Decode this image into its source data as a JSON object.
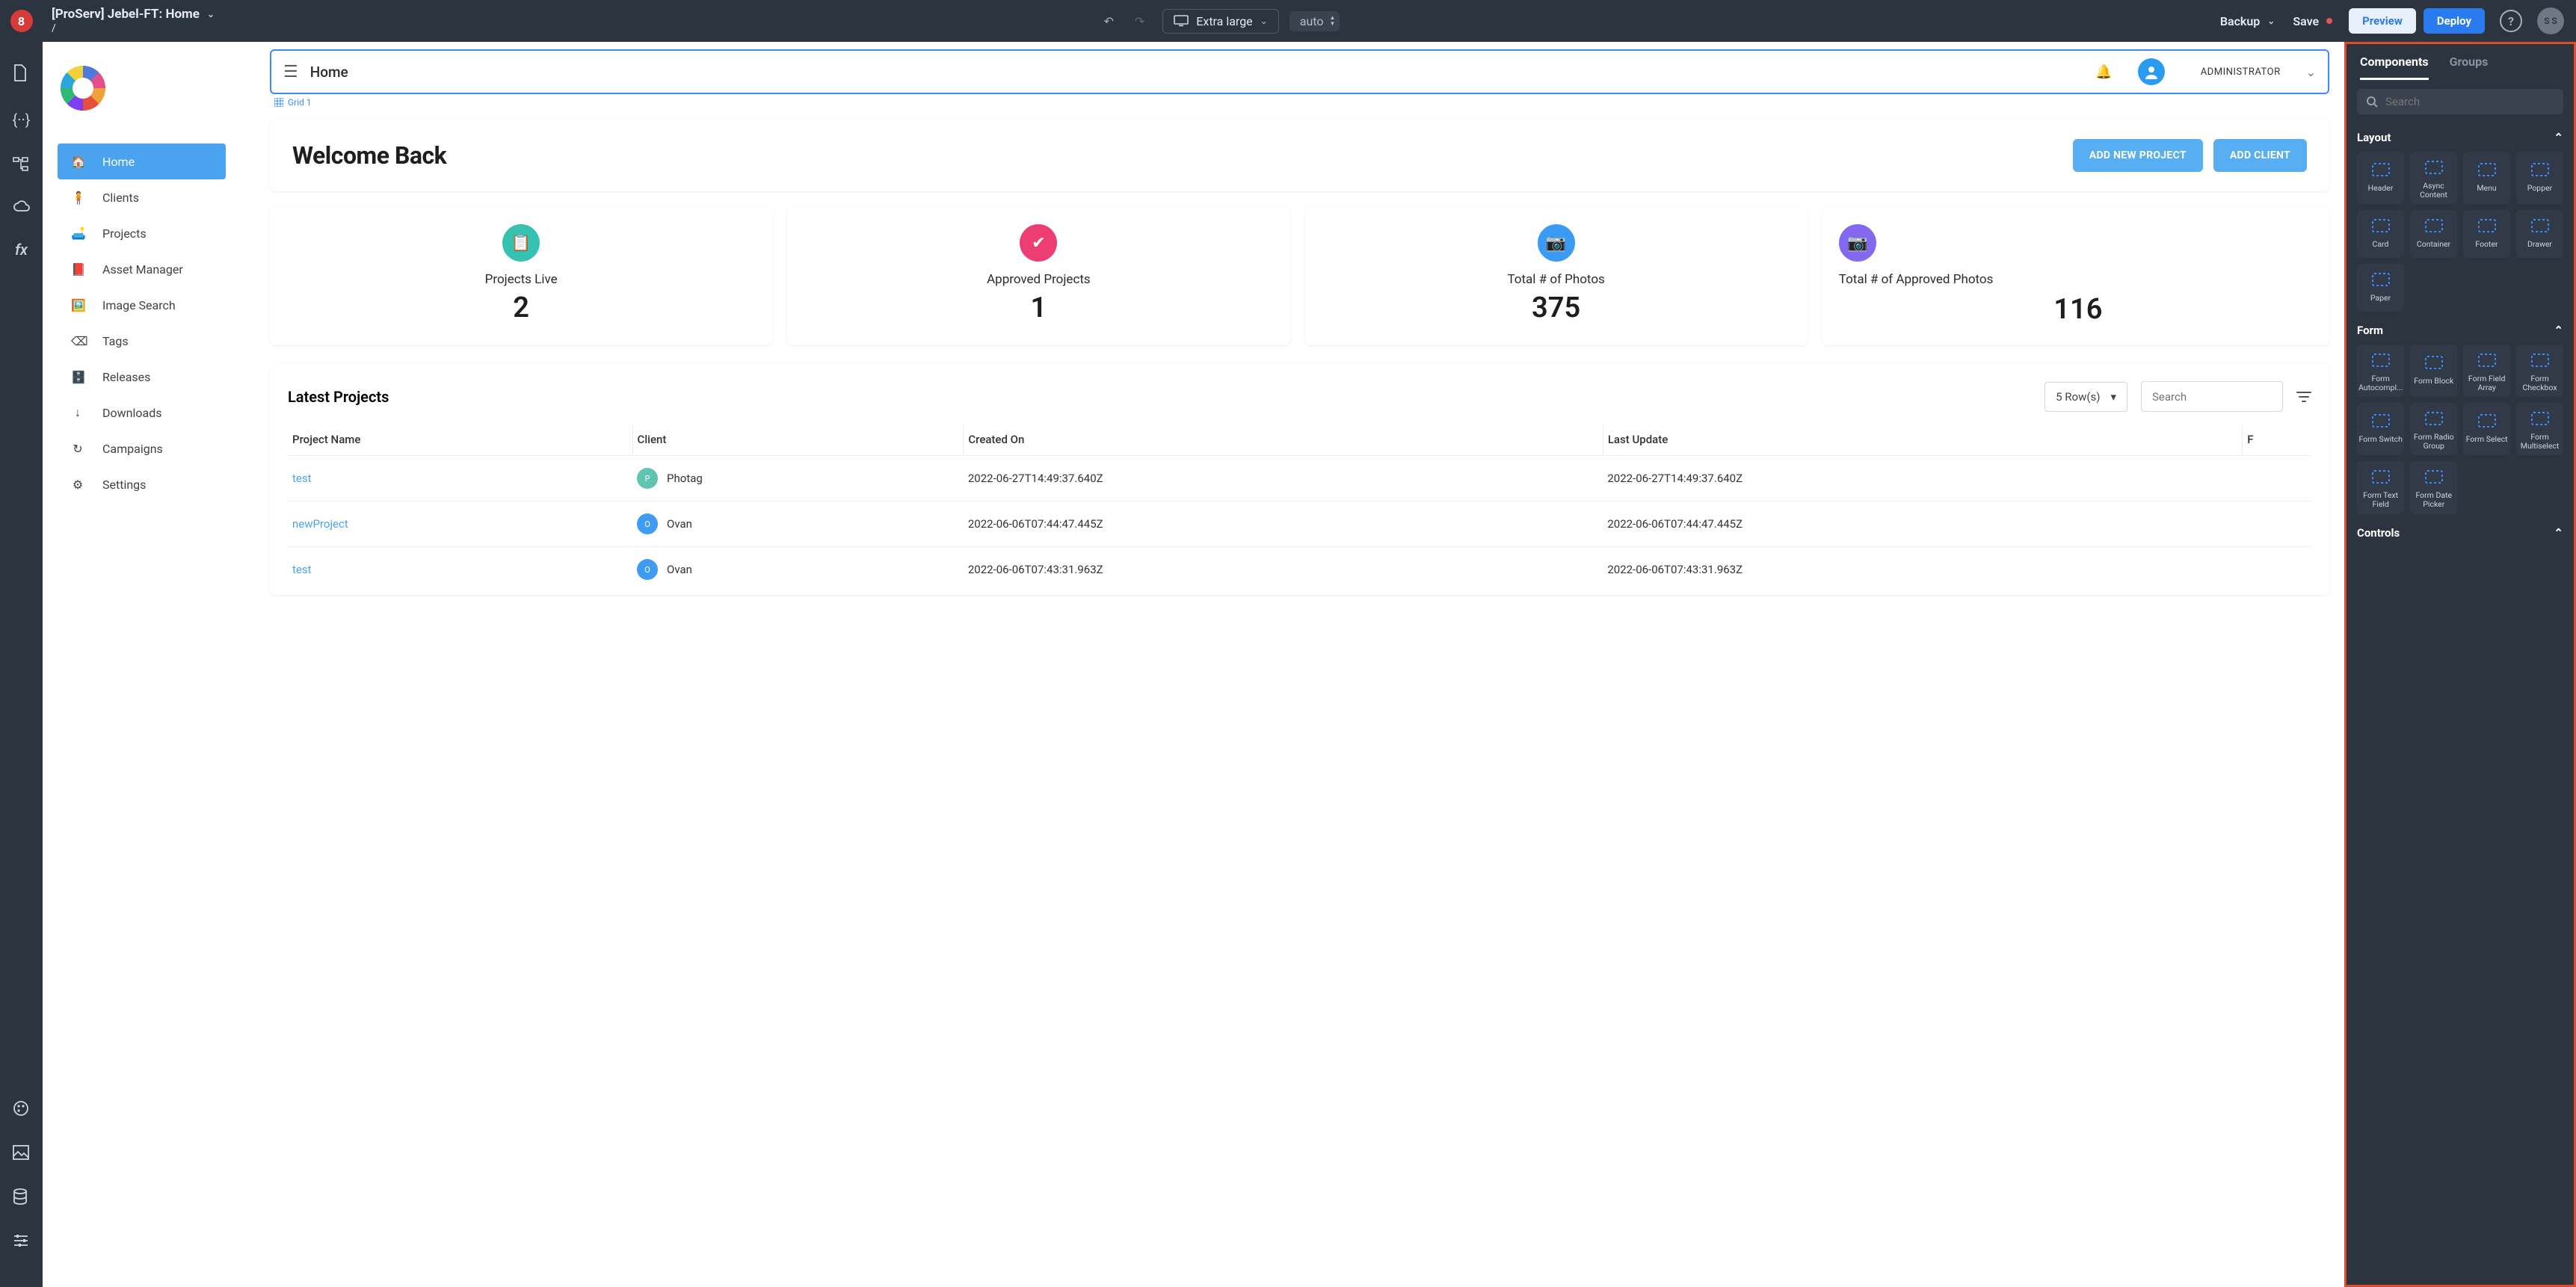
{
  "topbar": {
    "logo_text": "8",
    "title": "[ProServ] Jebel-FT: Home",
    "breadcrumb": "/",
    "viewport_label": "Extra large",
    "auto_label": "auto",
    "backup_label": "Backup",
    "save_label": "Save",
    "preview_label": "Preview",
    "deploy_label": "Deploy",
    "help_glyph": "?",
    "avatar_initials": "S S"
  },
  "appbar": {
    "title": "Home",
    "role": "ADMINISTRATOR",
    "grid_label": "Grid 1"
  },
  "hero": {
    "title": "Welcome Back",
    "add_project": "ADD NEW PROJECT",
    "add_client": "ADD CLIENT"
  },
  "stats": [
    {
      "label": "Projects Live",
      "value": "2",
      "color": "teal"
    },
    {
      "label": "Approved Projects",
      "value": "1",
      "color": "pink"
    },
    {
      "label": "Total # of Photos",
      "value": "375",
      "color": "blue"
    },
    {
      "label": "Total # of Approved Photos",
      "value": "116",
      "color": "purple"
    }
  ],
  "sidebar": {
    "items": [
      {
        "icon": "home",
        "label": "Home",
        "active": true
      },
      {
        "icon": "person",
        "label": "Clients"
      },
      {
        "icon": "folder",
        "label": "Projects"
      },
      {
        "icon": "book",
        "label": "Asset Manager"
      },
      {
        "icon": "image",
        "label": "Image Search"
      },
      {
        "icon": "tag",
        "label": "Tags"
      },
      {
        "icon": "archive",
        "label": "Releases"
      },
      {
        "icon": "download",
        "label": "Downloads"
      },
      {
        "icon": "campaign",
        "label": "Campaigns"
      },
      {
        "icon": "gear",
        "label": "Settings"
      }
    ]
  },
  "table": {
    "title": "Latest Projects",
    "row_selector": "5 Row(s)",
    "search_placeholder": "Search",
    "columns": [
      "Project Name",
      "Client",
      "Created On",
      "Last Update",
      "F"
    ],
    "rows": [
      {
        "name": "test",
        "client": "Photag",
        "badge": "P",
        "bclass": "p",
        "created": "2022-06-27T14:49:37.640Z",
        "updated": "2022-06-27T14:49:37.640Z"
      },
      {
        "name": "newProject",
        "client": "Ovan",
        "badge": "O",
        "bclass": "o",
        "created": "2022-06-06T07:44:47.445Z",
        "updated": "2022-06-06T07:44:47.445Z"
      },
      {
        "name": "test",
        "client": "Ovan",
        "badge": "O",
        "bclass": "o",
        "created": "2022-06-06T07:43:31.963Z",
        "updated": "2022-06-06T07:43:31.963Z"
      }
    ]
  },
  "right": {
    "tabs": {
      "components": "Components",
      "groups": "Groups"
    },
    "search_placeholder": "Search",
    "sections": {
      "layout": {
        "title": "Layout",
        "items": [
          "Header",
          "Async Content",
          "Menu",
          "Popper",
          "Card",
          "Container",
          "Footer",
          "Drawer",
          "Paper"
        ]
      },
      "form": {
        "title": "Form",
        "items": [
          "Form Autocompl...",
          "Form Block",
          "Form Field Array",
          "Form Checkbox",
          "Form Switch",
          "Form Radio Group",
          "Form Select",
          "Form Multiselect",
          "Form Text Field",
          "Form Date Picker"
        ]
      },
      "controls": {
        "title": "Controls"
      }
    }
  }
}
